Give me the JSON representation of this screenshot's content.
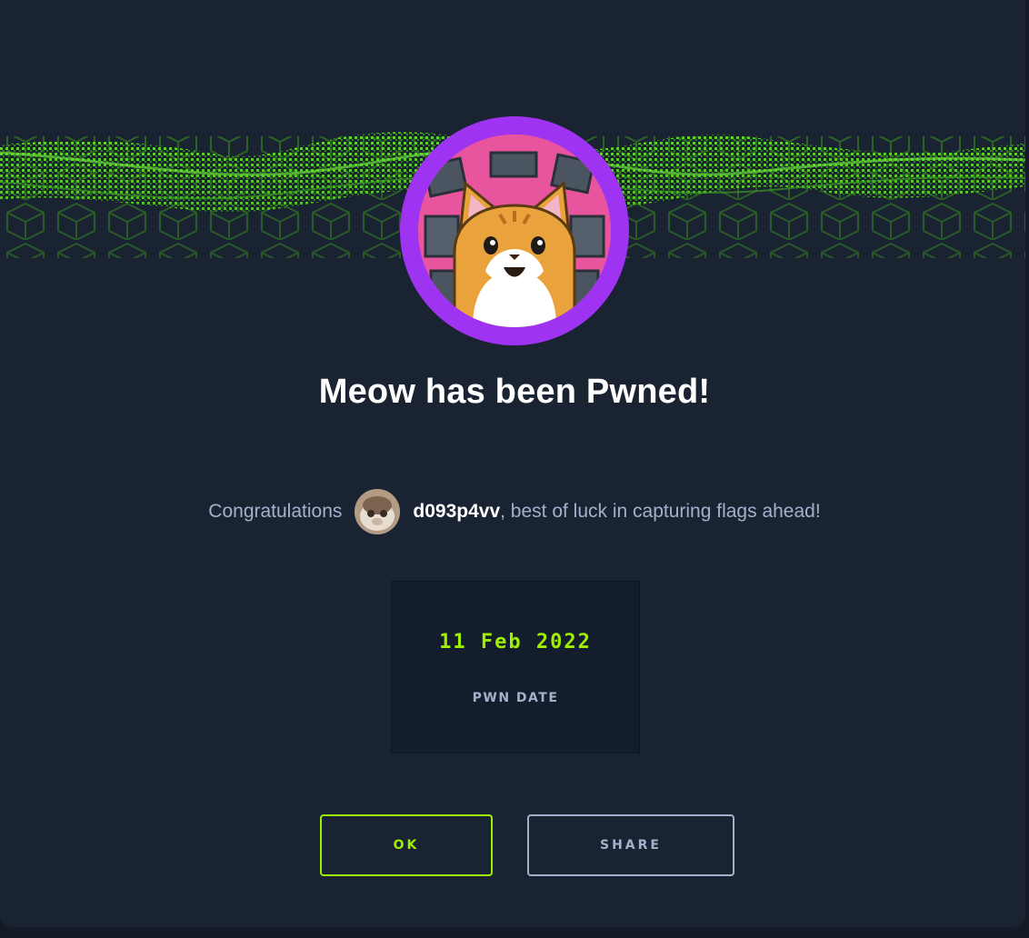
{
  "modal": {
    "title": "Meow has been Pwned!",
    "banner_icon": "green-wireframe-grid",
    "machine_avatar_icon": "cat-machine-avatar",
    "avatar_ring_color": "#9f33f2"
  },
  "congrats": {
    "prefix": "Congratulations",
    "user_avatar_icon": "user-avatar",
    "username": "d093p4vv",
    "suffix": ", best of luck in capturing flags ahead!"
  },
  "pwn": {
    "date": "11 Feb 2022",
    "label": "PWN DATE"
  },
  "buttons": {
    "ok_label": "OK",
    "share_label": "SHARE"
  },
  "colors": {
    "accent": "#9fef00",
    "muted": "#a4b1cd",
    "panel_bg": "#1a2332",
    "avatar_ring": "#9f33f2"
  }
}
